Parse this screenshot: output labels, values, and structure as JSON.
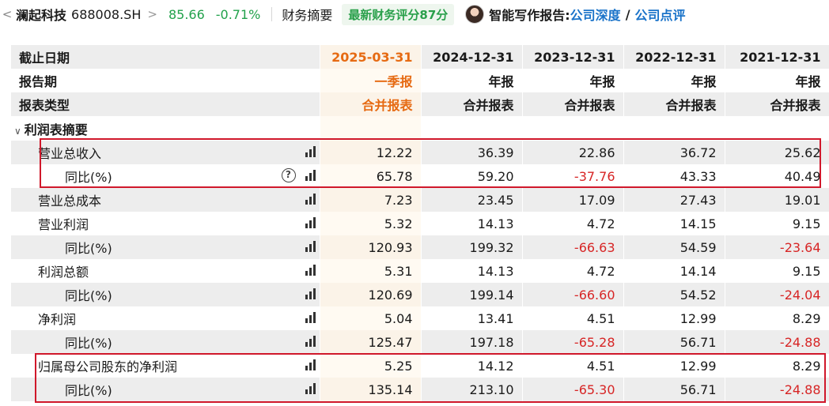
{
  "header": {
    "back_glyph": "<",
    "stock_name": "澜起科技",
    "stock_code": "688008.SH",
    "arrow_glyph": ">",
    "price": "85.66",
    "change": "-0.71%",
    "fin_summary": "财务摘要",
    "score_badge": "最新财务评分87分",
    "ai_report_title": "智能写作报告:",
    "report_deep": "公司深度",
    "slash": "/",
    "report_review": "公司点评",
    "price_color": "#21a14b"
  },
  "table": {
    "header_rows": [
      {
        "label": "截止日期",
        "cols": [
          "2025-03-31",
          "2024-12-31",
          "2023-12-31",
          "2022-12-31",
          "2021-12-31"
        ]
      },
      {
        "label": "报告期",
        "cols": [
          "一季报",
          "年报",
          "年报",
          "年报",
          "年报"
        ]
      },
      {
        "label": "报表类型",
        "cols": [
          "合并报表",
          "合并报表",
          "合并报表",
          "合并报表",
          "合并报表"
        ]
      }
    ],
    "section_label": "利润表摘要",
    "rows": [
      {
        "label": "营业总收入",
        "values": [
          "12.22",
          "36.39",
          "22.86",
          "36.72",
          "25.62"
        ],
        "sub": false,
        "help": false
      },
      {
        "label": "同比(%)",
        "values": [
          "65.78",
          "59.20",
          "-37.76",
          "43.33",
          "40.49"
        ],
        "sub": true,
        "help": true
      },
      {
        "label": "营业总成本",
        "values": [
          "7.23",
          "23.45",
          "17.09",
          "27.43",
          "19.01"
        ],
        "sub": false,
        "help": false
      },
      {
        "label": "营业利润",
        "values": [
          "5.32",
          "14.13",
          "4.72",
          "14.15",
          "9.15"
        ],
        "sub": false,
        "help": false
      },
      {
        "label": "同比(%)",
        "values": [
          "120.93",
          "199.32",
          "-66.63",
          "54.59",
          "-23.64"
        ],
        "sub": true,
        "help": false
      },
      {
        "label": "利润总额",
        "values": [
          "5.31",
          "14.13",
          "4.72",
          "14.14",
          "9.15"
        ],
        "sub": false,
        "help": false
      },
      {
        "label": "同比(%)",
        "values": [
          "120.69",
          "199.14",
          "-66.60",
          "54.52",
          "-24.04"
        ],
        "sub": true,
        "help": false
      },
      {
        "label": "净利润",
        "values": [
          "5.04",
          "13.41",
          "4.51",
          "12.99",
          "8.29"
        ],
        "sub": false,
        "help": false
      },
      {
        "label": "同比(%)",
        "values": [
          "125.47",
          "197.18",
          "-65.28",
          "56.71",
          "-24.88"
        ],
        "sub": true,
        "help": false
      },
      {
        "label": "归属母公司股东的净利润",
        "values": [
          "5.25",
          "14.12",
          "4.51",
          "12.99",
          "8.29"
        ],
        "sub": false,
        "help": false
      },
      {
        "label": "同比(%)",
        "values": [
          "135.14",
          "213.10",
          "-65.30",
          "56.71",
          "-24.88"
        ],
        "sub": true,
        "help": false
      }
    ],
    "help_glyph": "?",
    "negative_color": "#d72525",
    "current_period_color": "#e66a12",
    "highlight_box_color": "#d0182b"
  }
}
